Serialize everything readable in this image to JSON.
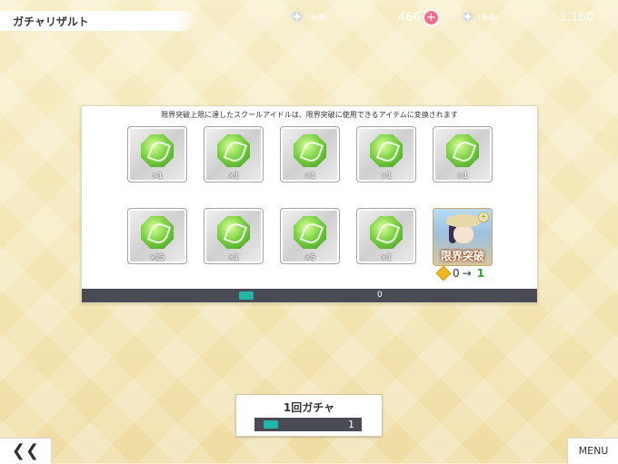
{
  "header": {
    "title": "ガチャリザルト"
  },
  "currency": {
    "paid_label": "(有償)",
    "paid_value": "466",
    "plus_symbol": "+",
    "free_label": "(無償)",
    "free_value": "1,160"
  },
  "panel": {
    "notice": "限界突破上限に達したスクールアイドルは、限界突破に使用できるアイテムに変換されます",
    "items": [
      {
        "qty": "×1"
      },
      {
        "qty": "×1"
      },
      {
        "qty": "×1"
      },
      {
        "qty": "×1"
      },
      {
        "qty": "×1"
      },
      {
        "qty": "×25"
      },
      {
        "qty": "×1"
      },
      {
        "qty": "×5"
      },
      {
        "qty": "×1"
      }
    ],
    "card": {
      "label": "限界突破",
      "from": "0",
      "arrow": "→",
      "to": "1"
    },
    "ticket_count": "0"
  },
  "gacha_button": {
    "label": "1回ガチャ",
    "count": "1"
  },
  "nav": {
    "back_symbol": "❮❮",
    "menu_label": "MENU"
  },
  "colors": {
    "accent_pink": "#f26f8b",
    "dark_bar": "#4b4b55",
    "ticket": "#23b5a8",
    "new_value_green": "#2f9c2f"
  }
}
